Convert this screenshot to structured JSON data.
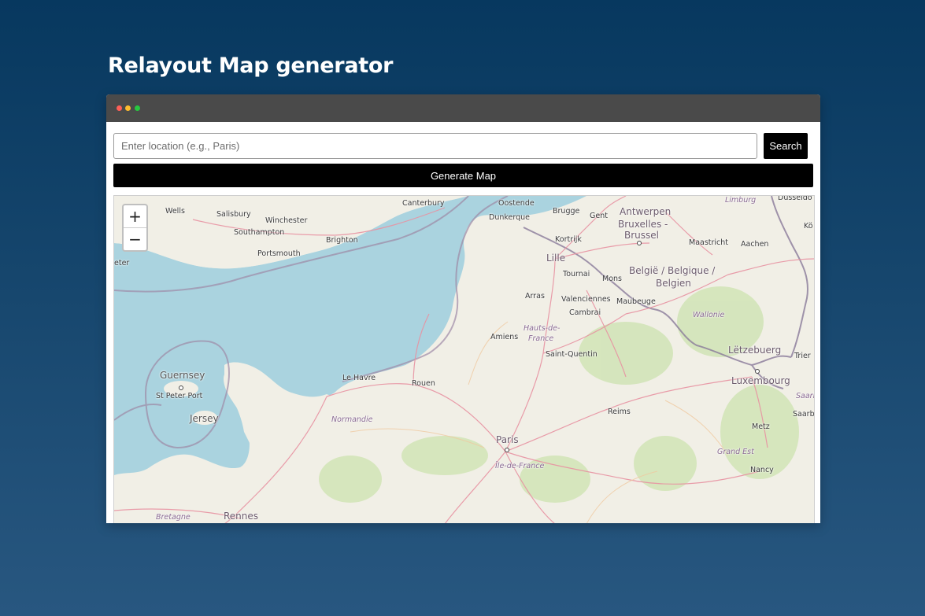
{
  "page": {
    "title": "Relayout Map generator"
  },
  "window": {
    "controls": [
      "close",
      "minimize",
      "maximize"
    ]
  },
  "search": {
    "placeholder": "Enter location (e.g., Paris)",
    "value": "",
    "button_label": "Search"
  },
  "generate": {
    "label": "Generate Map"
  },
  "map": {
    "zoom_in": "+",
    "zoom_out": "−",
    "labels": {
      "wells": "Wells",
      "salisbury": "Salisbury",
      "winchester": "Winchester",
      "southampton": "Southampton",
      "brighton": "Brighton",
      "portsmouth": "Portsmouth",
      "canterbury": "Canterbury",
      "ostende": "Oostende",
      "dunkerque": "Dunkerque",
      "brugge": "Brugge",
      "gent": "Gent",
      "antwerpen": "Antwerpen",
      "bruxelles": "Bruxelles -",
      "brussel": "Brussel",
      "limburg": "Limburg",
      "dusseldorf": "Düsseldo",
      "kortrijk": "Kortrijk",
      "lille": "Lille",
      "tournai": "Tournai",
      "mons": "Mons",
      "maastricht": "Maastricht",
      "aachen": "Aachen",
      "belgie": "België / Belgique /",
      "belgien": "Belgien",
      "arras": "Arras",
      "valenciennes": "Valenciennes",
      "maubeuge": "Maubeuge",
      "cambrai": "Cambrai",
      "wallonie": "Wallonie",
      "hautsdefrance1": "Hauts-de-",
      "hautsdefrance2": "France",
      "amiens": "Amiens",
      "saintquentin": "Saint-Quentin",
      "letzebuerg": "Lëtzebuerg",
      "trier": "Trier",
      "luxembourg": "Luxembourg",
      "guernsey": "Guernsey",
      "stpeterport": "St Peter Port",
      "jersey": "Jersey",
      "lehavre": "Le Havre",
      "rouen": "Rouen",
      "normandie": "Normandie",
      "reims": "Reims",
      "saarl": "Saarl",
      "saarb": "Saarb",
      "metz": "Metz",
      "paris": "Paris",
      "iledefrance": "Île-de-France",
      "grandest": "Grand Est",
      "nancy": "Nancy",
      "bretagne": "Bretagne",
      "rennes": "Rennes",
      "eter": "eter",
      "ko": "Kö"
    }
  },
  "colors": {
    "background_top": "#07385f",
    "background_bottom": "#285780",
    "titlebar": "#4a4a4a",
    "sea": "#aad3df",
    "land": "#f1efe6",
    "button": "#000000",
    "road": "#e892a2",
    "border": "#9e8aa6"
  }
}
